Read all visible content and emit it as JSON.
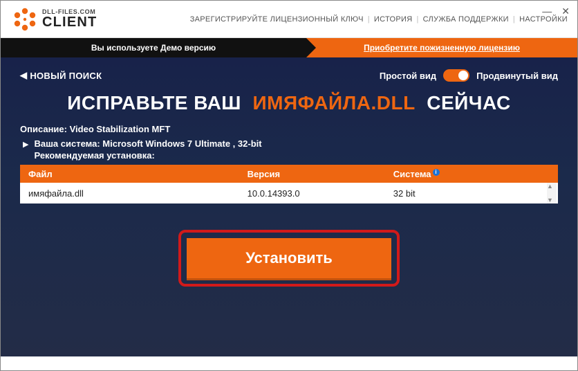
{
  "logo": {
    "small": "DLL-FILES.COM",
    "big": "CLIENT"
  },
  "top_links": {
    "register": "ЗАРЕГИСТРИРУЙТЕ ЛИЦЕНЗИОННЫЙ КЛЮЧ",
    "history": "ИСТОРИЯ",
    "support": "СЛУЖБА ПОДДЕРЖКИ",
    "settings": "НАСТРОЙКИ"
  },
  "demo_bar": {
    "left": "Вы используете Демо версию",
    "right": "Приобретите пожизненную лицензию"
  },
  "toolbar": {
    "new_search": "НОВЫЙ ПОИСК",
    "simple_view": "Простой вид",
    "advanced_view": "Продвинутый вид"
  },
  "headline": {
    "prefix": "ИСПРАВЬТЕ ВАШ",
    "filename": "ИМЯФАЙЛА",
    "ext": ".DLL",
    "suffix": "СЕЙЧАС"
  },
  "description": {
    "label": "Описание:",
    "value": "Video Stabilization MFT"
  },
  "system": {
    "label": "Ваша система:",
    "value": "Microsoft Windows 7 Ultimate , 32-bit"
  },
  "recommend": "Рекомендуемая установка:",
  "table": {
    "headers": {
      "file": "Файл",
      "version": "Версия",
      "system": "Система"
    },
    "rows": [
      {
        "file": "имяфайла.dll",
        "version": "10.0.14393.0",
        "system": "32 bit"
      }
    ]
  },
  "install": "Установить"
}
